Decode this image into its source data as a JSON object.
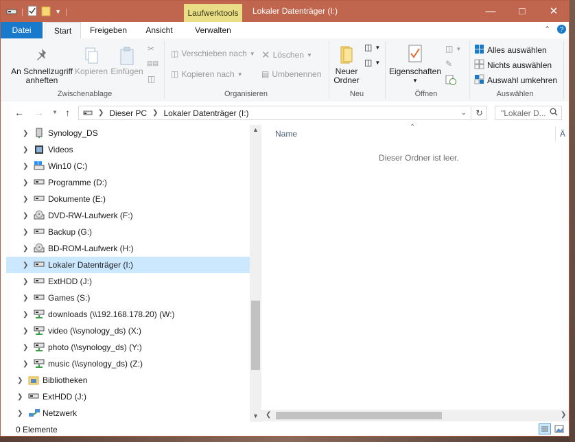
{
  "window": {
    "title": "Lokaler Datenträger (I:)",
    "context_tab": "Laufwerktools",
    "colors": {
      "titlebar": "#c0654e",
      "file_tab": "#1979ca",
      "context_tab": "#e9de86",
      "selection": "#cce8ff"
    }
  },
  "ribbon_tabs": {
    "datei": "Datei",
    "start": "Start",
    "freigeben": "Freigeben",
    "ansicht": "Ansicht",
    "verwalten": "Verwalten"
  },
  "ribbon": {
    "clipboard": {
      "pin": "An Schnellzugriff anheften",
      "copy": "Kopieren",
      "paste": "Einfügen",
      "label": "Zwischenablage"
    },
    "organize": {
      "move_to": "Verschieben nach",
      "copy_to": "Kopieren nach",
      "delete": "Löschen",
      "rename": "Umbenennen",
      "label": "Organisieren"
    },
    "new": {
      "new_folder": "Neuer Ordner",
      "label": "Neu"
    },
    "open": {
      "properties": "Eigenschaften",
      "label": "Öffnen"
    },
    "select": {
      "select_all": "Alles auswählen",
      "select_none": "Nichts auswählen",
      "invert": "Auswahl umkehren",
      "label": "Auswählen"
    }
  },
  "address": {
    "root": "Dieser PC",
    "current": "Lokaler Datenträger (I:)"
  },
  "search": {
    "placeholder": "\"Lokaler D..."
  },
  "tree": {
    "items": [
      {
        "label": "Synology_DS",
        "icon": "nas-icon"
      },
      {
        "label": "Videos",
        "icon": "videos-folder-icon"
      },
      {
        "label": "Win10 (C:)",
        "icon": "windows-drive-icon"
      },
      {
        "label": "Programme (D:)",
        "icon": "drive-icon"
      },
      {
        "label": "Dokumente (E:)",
        "icon": "drive-icon"
      },
      {
        "label": "DVD-RW-Laufwerk (F:)",
        "icon": "optical-drive-icon"
      },
      {
        "label": "Backup (G:)",
        "icon": "drive-icon"
      },
      {
        "label": "BD-ROM-Laufwerk (H:)",
        "icon": "optical-drive-icon"
      },
      {
        "label": "Lokaler Datenträger (I:)",
        "icon": "drive-icon",
        "selected": true
      },
      {
        "label": "ExtHDD (J:)",
        "icon": "drive-icon"
      },
      {
        "label": "Games (S:)",
        "icon": "drive-icon"
      },
      {
        "label": "downloads (\\\\192.168.178.20) (W:)",
        "icon": "network-drive-icon"
      },
      {
        "label": "video (\\\\synology_ds) (X:)",
        "icon": "network-drive-icon"
      },
      {
        "label": "photo (\\\\synology_ds) (Y:)",
        "icon": "network-drive-icon"
      },
      {
        "label": "music (\\\\synology_ds) (Z:)",
        "icon": "network-drive-icon"
      },
      {
        "label": "Bibliotheken",
        "icon": "libraries-icon",
        "level": 0
      },
      {
        "label": "ExtHDD (J:)",
        "icon": "drive-icon",
        "level": 0
      },
      {
        "label": "Netzwerk",
        "icon": "network-icon",
        "level": 0
      }
    ]
  },
  "content": {
    "col_name": "Name",
    "col_changed": "Ä",
    "empty_text": "Dieser Ordner ist leer."
  },
  "status": {
    "count": "0 Elemente"
  }
}
